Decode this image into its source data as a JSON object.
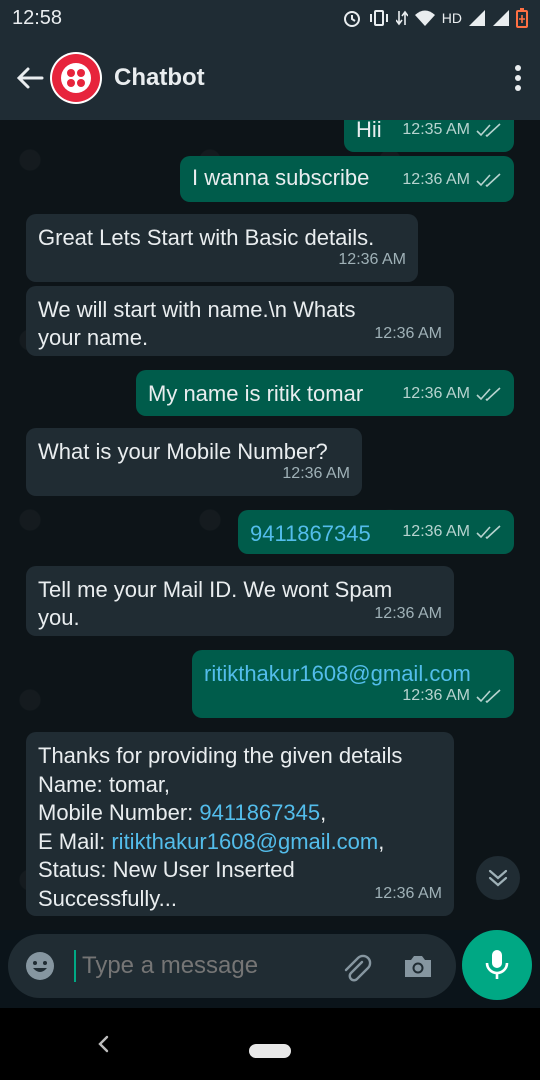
{
  "status_bar": {
    "time": "12:58",
    "network": "HD"
  },
  "header": {
    "title": "Chatbot"
  },
  "messages": [
    {
      "side": "out",
      "text": "Hii",
      "time": "12:35 AM"
    },
    {
      "side": "out",
      "text": "I wanna subscribe",
      "time": "12:36 AM"
    },
    {
      "side": "in",
      "text": "Great Lets Start with Basic details.",
      "time": "12:36 AM"
    },
    {
      "side": "in",
      "text": "We will start with name.\\n Whats your name.",
      "time": "12:36 AM"
    },
    {
      "side": "out",
      "text": "My name is ritik tomar",
      "time": "12:36 AM"
    },
    {
      "side": "in",
      "text": "What is your Mobile Number?",
      "time": "12:36 AM"
    },
    {
      "side": "out",
      "text": "9411867345",
      "time": "12:36 AM"
    },
    {
      "side": "in",
      "text": "Tell me your Mail ID. We wont Spam you.",
      "time": "12:36 AM"
    },
    {
      "side": "out",
      "text": "ritikthakur1608@gmail.com",
      "time": "12:36 AM"
    },
    {
      "side": "in",
      "line1": "Thanks for providing the given details",
      "line2": "Name: tomar,",
      "mobile_label": "Mobile Number: ",
      "mobile_value": "9411867345",
      "mobile_suffix": ",",
      "email_label": "E Mail: ",
      "email_value": "ritikthakur1608@gmail.com",
      "email_suffix": ",",
      "line5": "Status: New User Inserted",
      "line6": "Successfully...",
      "time": "12:36 AM"
    }
  ],
  "composer": {
    "placeholder": "Type a message"
  },
  "colors": {
    "accent": "#00a884",
    "outgoing": "#005c4b",
    "incoming": "#202c33",
    "link": "#53bdeb"
  }
}
